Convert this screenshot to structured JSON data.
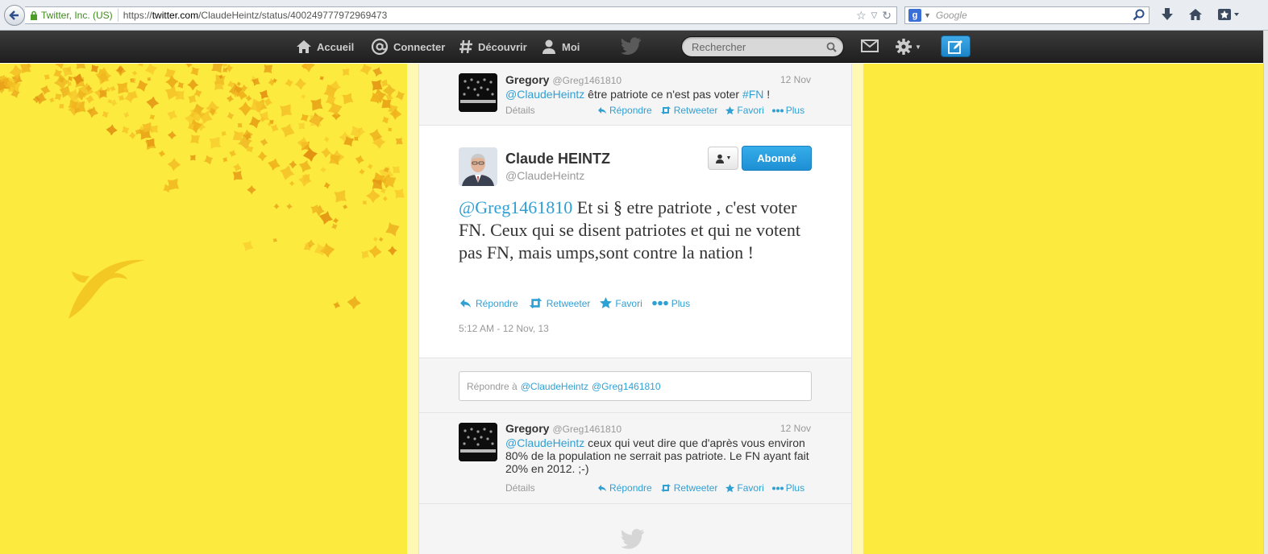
{
  "browser": {
    "site_identity": "Twitter, Inc. (US)",
    "url_prefix": "https://",
    "url_domain": "twitter.com",
    "url_path": "/ClaudeHeintz/status/400249777972969473",
    "search_placeholder": "Google"
  },
  "topbar": {
    "nav": [
      {
        "label": "Accueil",
        "icon": "home-icon"
      },
      {
        "label": "Connecter",
        "icon": "at-icon"
      },
      {
        "label": "Découvrir",
        "icon": "hash-icon"
      },
      {
        "label": "Moi",
        "icon": "person-icon"
      }
    ],
    "search_placeholder": "Rechercher"
  },
  "tweets_above": [
    {
      "name": "Gregory",
      "handle": "@Greg1461810",
      "date": "12 Nov",
      "mention": "@ClaudeHeintz",
      "text": " être patriote ce n'est pas voter ",
      "hashtag": "#FN",
      "text_end": " !",
      "details": "Détails",
      "actions": [
        "Répondre",
        "Retweeter",
        "Favori",
        "Plus"
      ]
    }
  ],
  "main_tweet": {
    "name": "Claude HEINTZ",
    "handle": "@ClaudeHeintz",
    "follow_label": "Abonné",
    "mention": "@Greg1461810",
    "text": " Et si § etre patriote , c'est voter FN. Ceux qui se disent patriotes et qui ne votent pas FN, mais umps,sont contre la nation !",
    "actions": [
      "Répondre",
      "Retweeter",
      "Favori",
      "Plus"
    ],
    "timestamp": "5:12 AM - 12 Nov, 13"
  },
  "reply": {
    "prefix": "Répondre à",
    "mention1": "@ClaudeHeintz",
    "mention2": "@Greg1461810"
  },
  "tweets_below": [
    {
      "name": "Gregory",
      "handle": "@Greg1461810",
      "date": "12 Nov",
      "mention": "@ClaudeHeintz",
      "text": " ceux qui veut dire que d'après vous environ 80% de la population ne serrait pas patriote. Le FN ayant fait 20% en 2012. ;-)",
      "details": "Détails",
      "actions": [
        "Répondre",
        "Retweeter",
        "Favori",
        "Plus"
      ]
    }
  ],
  "colors": {
    "link": "#2fa0d4",
    "background": "#fdea3f",
    "topbar": "#2b2b2b",
    "follow_button": "#1d8fd4"
  }
}
